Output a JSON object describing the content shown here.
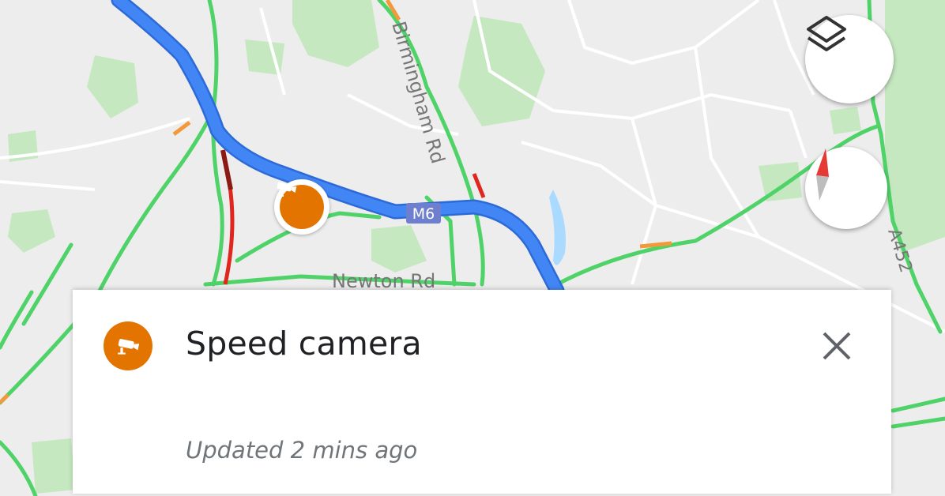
{
  "map": {
    "road_labels": {
      "birmingham_rd": "Birmingham Rd",
      "m6": "M6",
      "newton_rd": "Newton Rd",
      "a452": "A452"
    },
    "colors": {
      "route": "#4285f4",
      "traffic_fast": "#4fd368",
      "traffic_slow": "#f29a3b",
      "traffic_heavy": "#e0261d",
      "traffic_severe": "#8b1a14",
      "park": "#c5e8c0",
      "marker": "#e37400",
      "motorway_shield": "#6f7fcf"
    },
    "layers_button": {
      "icon": "layers-icon"
    },
    "compass_button": {
      "icon": "compass-icon"
    },
    "speed_camera_marker": {
      "icon": "speed-camera-icon"
    }
  },
  "card": {
    "icon": "speed-camera-icon",
    "title": "Speed camera",
    "updated": "Updated 2 mins ago",
    "close_icon": "close-icon"
  }
}
